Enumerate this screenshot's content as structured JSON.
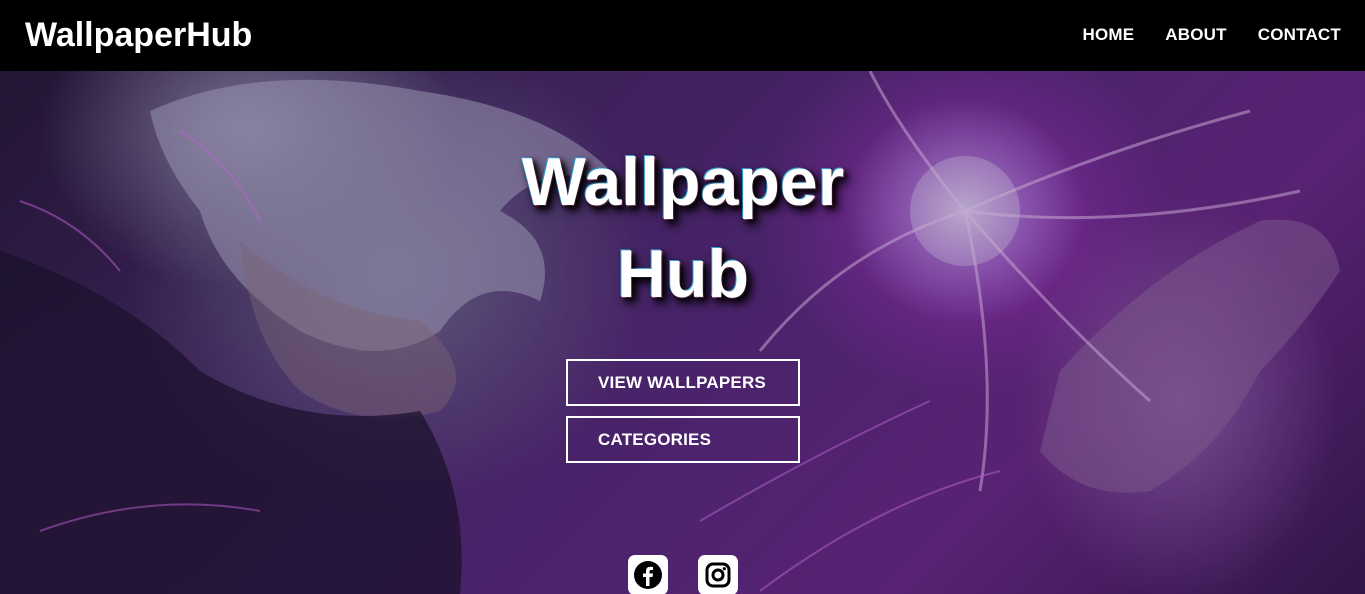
{
  "header": {
    "logo": "WallpaperHub",
    "nav": [
      {
        "label": "HOME"
      },
      {
        "label": "ABOUT"
      },
      {
        "label": "CONTACT"
      }
    ]
  },
  "hero": {
    "title_line1": "Wallpaper",
    "title_line2": "Hub",
    "buttons": {
      "view_wallpapers": "VIEW WALLPAPERS",
      "categories": "CATEGORIES"
    },
    "background_description_icon": "anime-character-background-image"
  },
  "social": [
    {
      "icon": "facebook-icon"
    },
    {
      "icon": "instagram-icon"
    }
  ],
  "colors": {
    "navbar_bg": "#000000",
    "text": "#ffffff",
    "accent_purple": "#6d2a8c"
  }
}
